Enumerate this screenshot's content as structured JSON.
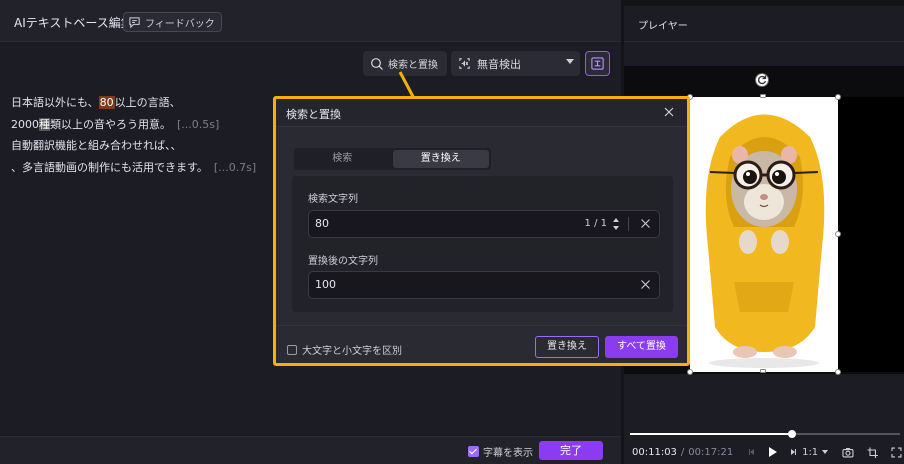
{
  "left_panel": {
    "title": "AIテキストベース編集",
    "feedback_label": "フィードバック",
    "search_replace_button": "検索と置換",
    "silence_detect_label": "無音検出",
    "transcript": {
      "line1_pre": "日本語以外にも、",
      "line1_hl": "80",
      "line1_post": "以上の言語、",
      "line2_pre": "2000",
      "line2_hl": "種",
      "line2_post": "類以上の音やろう用意。",
      "line2_tag": "[...0.5s]",
      "line3": "自動翻訳機能と組み合わせれば、、",
      "line4": "、多言語動画の制作にも活用できます。",
      "line4_tag": "[...0.7s]"
    },
    "footer": {
      "show_subtitles_label": "字幕を表示",
      "done_label": "完了"
    }
  },
  "player": {
    "title": "プレイヤー",
    "current_time": "00:11:03",
    "total_time": "00:17:21",
    "progress": 0.6,
    "zoom": "1:1"
  },
  "dialog": {
    "title": "検索と置換",
    "tabs": [
      {
        "label": "検索",
        "active": false
      },
      {
        "label": "置き換え",
        "active": true
      }
    ],
    "search_label": "検索文字列",
    "search_value": "80",
    "match_count": "1 / 1",
    "replace_label": "置換後の文字列",
    "replace_value": "100",
    "case_sensitive_label": "大文字と小文字を区別",
    "replace_button": "置き換え",
    "replace_all_button": "すべて置換"
  },
  "colors": {
    "accent": "#8b3cf0",
    "highlight": "#f5b10a"
  }
}
